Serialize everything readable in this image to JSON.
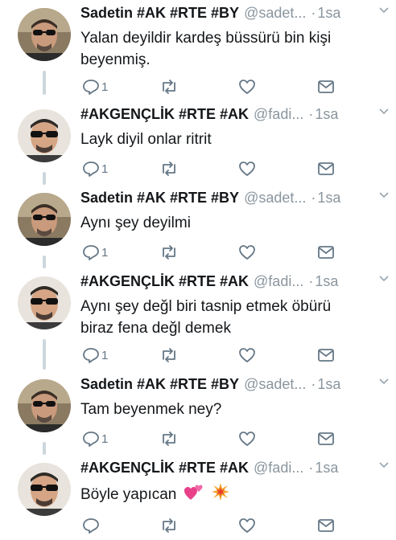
{
  "tweets": [
    {
      "name": "Sadetin #AK #RTE #BY",
      "handle": "@sadet...",
      "dot": "·",
      "time": "1sa",
      "text_lines": [
        "Yalan deyildir kardeş büssürü bin kişi",
        "beyenmiş."
      ],
      "reply_count": "1",
      "avatar": "avatar-a"
    },
    {
      "name": "#AKGENÇLİK #RTE #AK",
      "handle": "@fadi...",
      "dot": "·",
      "time": "1sa",
      "text_lines": [
        "Layk diyil onlar ritrit"
      ],
      "reply_count": "1",
      "avatar": "avatar-b"
    },
    {
      "name": "Sadetin #AK #RTE #BY",
      "handle": "@sadet...",
      "dot": "·",
      "time": "1sa",
      "text_lines": [
        "Aynı şey deyilmi"
      ],
      "reply_count": "1",
      "avatar": "avatar-a"
    },
    {
      "name": "#AKGENÇLİK #RTE #AK",
      "handle": "@fadi...",
      "dot": "·",
      "time": "1sa",
      "text_lines": [
        "Aynı şey değl biri tasnip etmek öbürü",
        "biraz fena değl demek"
      ],
      "reply_count": "1",
      "avatar": "avatar-b"
    },
    {
      "name": "Sadetin #AK #RTE #BY",
      "handle": "@sadet...",
      "dot": "·",
      "time": "1sa",
      "text_lines": [
        "Tam beyenmek ney?"
      ],
      "reply_count": "1",
      "avatar": "avatar-a"
    },
    {
      "name": "#AKGENÇLİK #RTE #AK",
      "handle": "@fadi...",
      "dot": "·",
      "time": "1sa",
      "text_lines": [
        "Böyle yapıcan"
      ],
      "reply_count": "",
      "avatar": "avatar-b",
      "emojis": [
        "two-hearts-emoji",
        "collision-emoji"
      ]
    }
  ],
  "icons": {
    "reply": "reply-icon",
    "retweet": "retweet-icon",
    "like": "heart-icon",
    "dm": "envelope-icon",
    "caret": "chevron-down-icon"
  },
  "colors": {
    "icon": "#657786",
    "thread_line": "#ccd6dd",
    "meta": "#8a959e"
  }
}
